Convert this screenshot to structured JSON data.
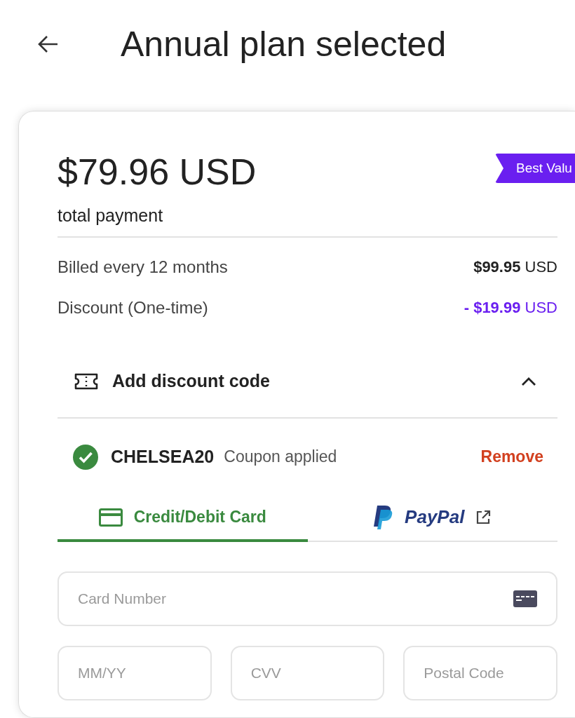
{
  "header": {
    "title": "Annual plan selected"
  },
  "plan": {
    "price": "$79.96 USD",
    "price_caption": "total payment",
    "badge": "Best Valu"
  },
  "lines": [
    {
      "label": "Billed every 12 months",
      "amount": "$99.95",
      "currency": "USD",
      "kind": "charge"
    },
    {
      "label": "Discount (One-time)",
      "amount": "- $19.99",
      "currency": "USD",
      "kind": "discount"
    }
  ],
  "discount_code": {
    "label": "Add discount code",
    "expanded": true
  },
  "coupon": {
    "code": "CHELSEA20",
    "status": "Coupon applied",
    "remove": "Remove"
  },
  "payment_tabs": [
    {
      "label": "Credit/Debit Card",
      "kind": "card",
      "selected": true
    },
    {
      "label": "PayPal",
      "kind": "paypal",
      "selected": false
    }
  ],
  "card_fields": [
    {
      "placeholder": "Card Number"
    },
    {
      "placeholder": "MM/YY"
    },
    {
      "placeholder": "CVV"
    },
    {
      "placeholder": "Postal Code"
    }
  ]
}
